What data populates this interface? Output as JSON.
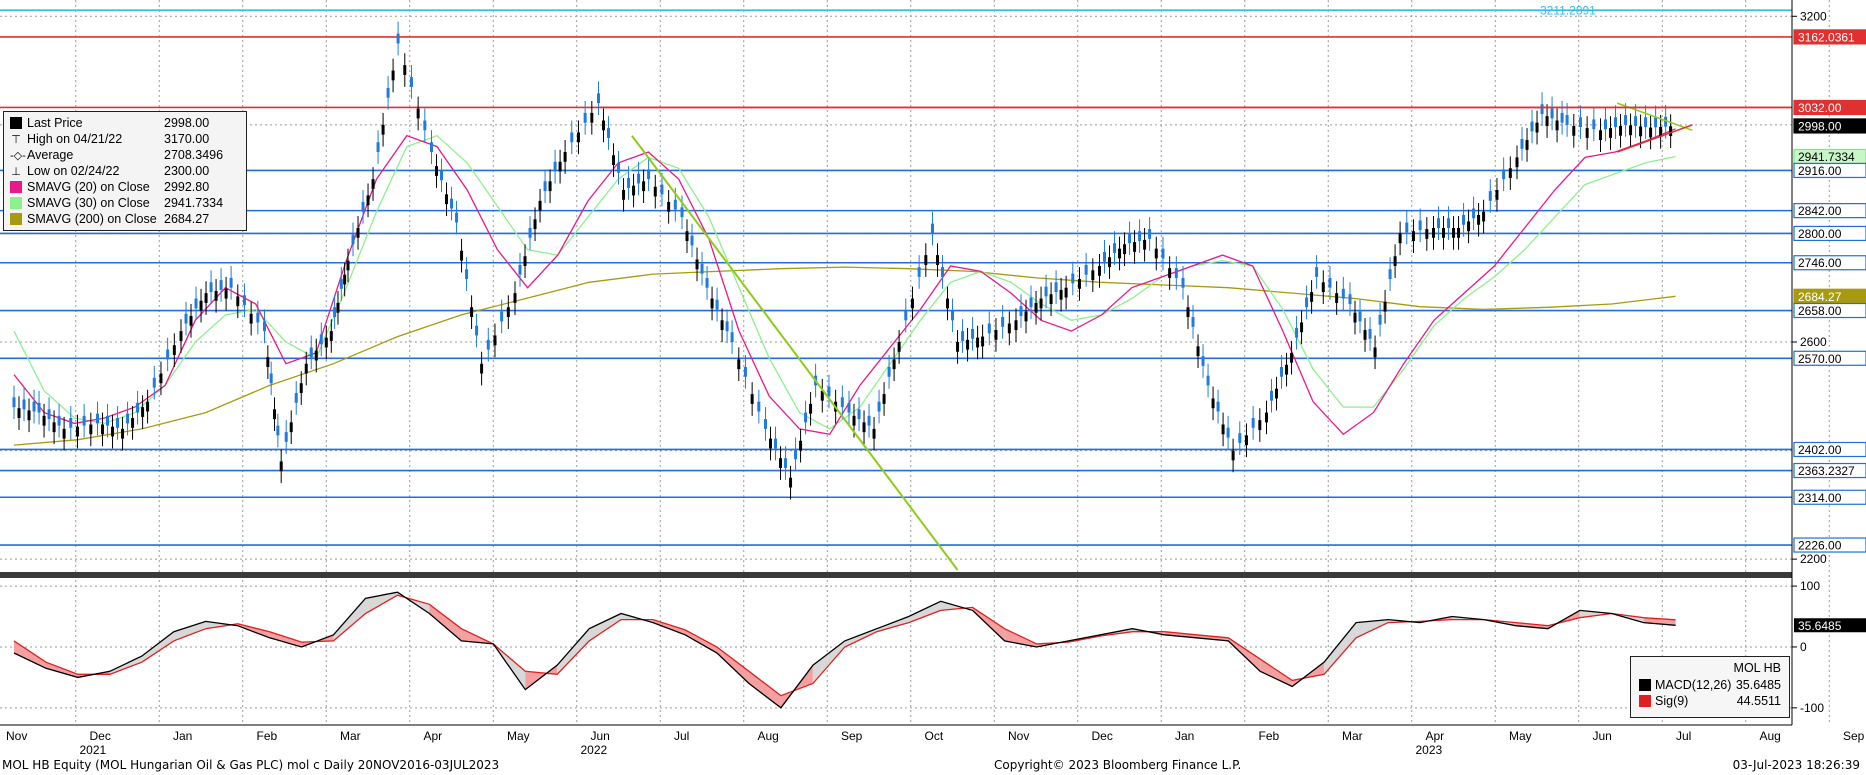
{
  "chart_data": {
    "type": "candlestick",
    "title": "MOL HB Equity (MOL Hungarian Oil & Gas PLC) mol c  Daily 20NOV2016-03JUL2023",
    "x_labels": [
      "Nov",
      "Dec",
      "Jan",
      "Feb",
      "Mar",
      "Apr",
      "May",
      "Jun",
      "Jul",
      "Aug",
      "Sep",
      "Oct",
      "Nov",
      "Dec",
      "Jan",
      "Feb",
      "Mar",
      "Apr",
      "May",
      "Jun",
      "Jul",
      "Aug",
      "Sep"
    ],
    "year_labels": [
      {
        "text": "2021",
        "at_month": "Dec"
      },
      {
        "text": "2022",
        "at_month": "Jul"
      },
      {
        "text": "2023",
        "at_month": "May"
      }
    ],
    "price_axis": {
      "ticks": [
        3200,
        2600,
        2200
      ],
      "ylim": [
        2180,
        3230
      ]
    },
    "price_series": {
      "name": "Last Price",
      "x_month_index": [
        0.0,
        0.3,
        0.6,
        1.0,
        1.3,
        1.6,
        2.0,
        2.3,
        2.6,
        3.0,
        3.2,
        3.5,
        3.8,
        4.0,
        4.3,
        4.6,
        5.0,
        5.3,
        5.6,
        6.0,
        6.3,
        6.6,
        7.0,
        7.3,
        7.6,
        8.0,
        8.3,
        8.6,
        9.0,
        9.3,
        9.6,
        10.0,
        10.3,
        10.6,
        11.0,
        11.3,
        11.6,
        12.0,
        12.3,
        12.6,
        13.0,
        13.3,
        13.6,
        14.0,
        14.3,
        14.6,
        15.0,
        15.3,
        15.6,
        16.0,
        16.3,
        16.6,
        17.0,
        17.3,
        17.6,
        18.0,
        18.3,
        18.6,
        19.0,
        19.3,
        19.6,
        19.9
      ],
      "close": [
        2480,
        2470,
        2440,
        2450,
        2440,
        2490,
        2620,
        2690,
        2700,
        2620,
        2380,
        2560,
        2620,
        2750,
        2900,
        3150,
        2950,
        2820,
        2560,
        2690,
        2860,
        2950,
        3040,
        2880,
        2900,
        2830,
        2700,
        2600,
        2440,
        2350,
        2520,
        2470,
        2440,
        2600,
        2800,
        2600,
        2610,
        2640,
        2680,
        2700,
        2740,
        2780,
        2790,
        2700,
        2520,
        2400,
        2470,
        2580,
        2720,
        2670,
        2590,
        2800,
        2810,
        2810,
        2840,
        2940,
        3020,
        3000,
        2990,
        3000,
        2995,
        2998
      ],
      "high": 3170,
      "high_date": "04/21/22",
      "low": 2300,
      "low_date": "02/24/22"
    },
    "sma20_values": [
      2540,
      2470,
      2450,
      2460,
      2480,
      2520,
      2640,
      2700,
      2670,
      2560,
      2580,
      2750,
      2900,
      2980,
      2960,
      2880,
      2770,
      2700,
      2760,
      2860,
      2930,
      2950,
      2900,
      2790,
      2620,
      2500,
      2440,
      2430,
      2520,
      2590,
      2660,
      2740,
      2730,
      2690,
      2640,
      2620,
      2650,
      2700,
      2720,
      2740,
      2760,
      2740,
      2620,
      2490,
      2430,
      2470,
      2560,
      2640,
      2690,
      2740,
      2810,
      2880,
      2940,
      2950,
      2970,
      2992.8
    ],
    "sma30_values": [
      2620,
      2510,
      2460,
      2450,
      2470,
      2520,
      2600,
      2650,
      2660,
      2600,
      2570,
      2700,
      2840,
      2960,
      2980,
      2930,
      2850,
      2770,
      2760,
      2830,
      2900,
      2940,
      2920,
      2830,
      2700,
      2570,
      2470,
      2440,
      2480,
      2560,
      2640,
      2710,
      2730,
      2710,
      2670,
      2640,
      2650,
      2680,
      2720,
      2740,
      2750,
      2740,
      2660,
      2550,
      2480,
      2480,
      2550,
      2630,
      2680,
      2720,
      2770,
      2830,
      2890,
      2910,
      2930,
      2941.73
    ],
    "sma200_values": [
      2410,
      2420,
      2440,
      2470,
      2520,
      2560,
      2610,
      2650,
      2680,
      2710,
      2725,
      2730,
      2735,
      2738,
      2735,
      2730,
      2718,
      2710,
      2705,
      2700,
      2690,
      2680,
      2665,
      2660,
      2664,
      2670,
      2684.27
    ],
    "horizontal_levels": [
      {
        "value": 3211.2891,
        "label": "3211.2891",
        "color": "#33bde8"
      },
      {
        "value": 3162.0361,
        "label": "3162.0361",
        "color": "#e03030"
      },
      {
        "value": 3032.0,
        "label": "3032.00",
        "color": "#e03030"
      },
      {
        "value": 2998.0,
        "label": "2998.00",
        "color": "#000000"
      },
      {
        "value": 2941.7334,
        "label": "2941.7334",
        "color": "#7de87d"
      },
      {
        "value": 2916.0,
        "label": "2916.00",
        "color": "#1f6fd6"
      },
      {
        "value": 2842.0,
        "label": "2842.00",
        "color": "#1f6fd6"
      },
      {
        "value": 2800.0,
        "label": "2800.00",
        "color": "#1f6fd6"
      },
      {
        "value": 2746.0,
        "label": "2746.00",
        "color": "#1f6fd6"
      },
      {
        "value": 2684.27,
        "label": "2684.27",
        "color": "#a89a10"
      },
      {
        "value": 2658.0,
        "label": "2658.00",
        "color": "#1f6fd6"
      },
      {
        "value": 2570.0,
        "label": "2570.00",
        "color": "#1f6fd6"
      },
      {
        "value": 2402.0,
        "label": "2402.00",
        "color": "#1f6fd6"
      },
      {
        "value": 2363.2327,
        "label": "2363.2327",
        "color": "#1f6fd6"
      },
      {
        "value": 2314.0,
        "label": "2314.00",
        "color": "#1f6fd6"
      },
      {
        "value": 2226.0,
        "label": "2226.00",
        "color": "#1f6fd6"
      }
    ],
    "legend": [
      {
        "name": "Last Price",
        "value": "2998.00",
        "marker": "square",
        "color": "#000000"
      },
      {
        "name": "High on 04/21/22",
        "value": "3170.00",
        "marker": "high"
      },
      {
        "name": "Average",
        "value": "2708.3496",
        "marker": "avg"
      },
      {
        "name": "Low on 02/24/22",
        "value": "2300.00",
        "marker": "low"
      },
      {
        "name": "SMAVG (20)  on Close",
        "value": "2992.80",
        "marker": "square",
        "color": "#e8198b"
      },
      {
        "name": "SMAVG (30)  on Close",
        "value": "2941.7334",
        "marker": "square",
        "color": "#8df08d"
      },
      {
        "name": "SMAVG (200)  on Close",
        "value": "2684.27",
        "marker": "square",
        "color": "#a89a10"
      }
    ],
    "macd": {
      "title": "MOL HB",
      "ticks": [
        100,
        0,
        -100
      ],
      "ylim": [
        -120,
        110
      ],
      "macd_name": "MACD(12,26)",
      "macd_last": "35.6485",
      "macd_color": "#000000",
      "signal_name": "Sig(9)",
      "signal_last": "44.5511",
      "signal_color": "#e02020",
      "macd_values": [
        -10,
        -35,
        -50,
        -40,
        -15,
        25,
        42,
        35,
        15,
        0,
        20,
        80,
        90,
        55,
        10,
        5,
        -70,
        -30,
        30,
        55,
        40,
        20,
        -10,
        -60,
        -100,
        -30,
        10,
        30,
        50,
        75,
        60,
        10,
        0,
        10,
        20,
        30,
        20,
        15,
        10,
        -40,
        -65,
        -25,
        40,
        45,
        40,
        50,
        45,
        35,
        30,
        60,
        55,
        40,
        35.6485
      ],
      "signal_values": [
        10,
        -25,
        -45,
        -45,
        -25,
        10,
        30,
        38,
        25,
        8,
        10,
        55,
        85,
        70,
        30,
        5,
        -40,
        -45,
        10,
        45,
        45,
        28,
        0,
        -40,
        -80,
        -60,
        0,
        25,
        40,
        60,
        65,
        30,
        5,
        8,
        18,
        25,
        25,
        20,
        15,
        -20,
        -55,
        -45,
        15,
        40,
        42,
        45,
        45,
        40,
        35,
        48,
        55,
        48,
        44.5511
      ]
    }
  },
  "footer": {
    "left": "MOL HB Equity (MOL Hungarian Oil & Gas PLC) mol c  Daily 20NOV2016-03JUL2023",
    "center": "Copyright© 2023 Bloomberg Finance L.P.",
    "right": "03-Jul-2023 18:26:39"
  },
  "colors": {
    "candle_up": "#000000",
    "candle_down": "#1f7be0",
    "trend_green": "#8dcc1a",
    "grid": "#9a9a9a"
  }
}
